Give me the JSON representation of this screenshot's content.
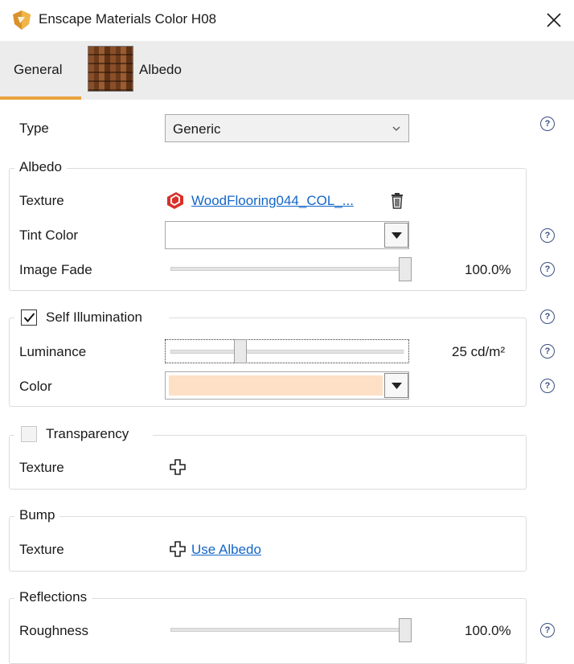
{
  "window": {
    "title": "Enscape Materials Color H08",
    "close_glyph": "✕"
  },
  "tabs": [
    {
      "label": "General",
      "active": true
    },
    {
      "label": "Albedo",
      "active": false
    }
  ],
  "type_row": {
    "label": "Type",
    "value": "Generic"
  },
  "albedo_group": {
    "title": "Albedo",
    "texture_label": "Texture",
    "texture_file": "WoodFlooring044_COL_...",
    "tint_label": "Tint Color",
    "tint_value": "",
    "fade_label": "Image Fade",
    "fade_value": "100.0%",
    "fade_fraction": 1.0
  },
  "self_illumination": {
    "title": "Self Illumination",
    "checked": true,
    "luminance_label": "Luminance",
    "luminance_value": "25 cd/m²",
    "luminance_fraction": 0.29,
    "color_label": "Color",
    "color_hex": "#fde0c6"
  },
  "transparency": {
    "title": "Transparency",
    "checked": false,
    "texture_label": "Texture"
  },
  "bump": {
    "title": "Bump",
    "texture_label": "Texture",
    "link": "Use Albedo"
  },
  "reflections": {
    "title": "Reflections",
    "roughness_label": "Roughness",
    "roughness_value": "100.0%",
    "roughness_fraction": 1.0
  },
  "help_glyph": "?",
  "colors": {
    "accent": "#e8a23a",
    "link": "#1466c8",
    "tab_bg": "#ececec",
    "help": "#3a4f80"
  }
}
